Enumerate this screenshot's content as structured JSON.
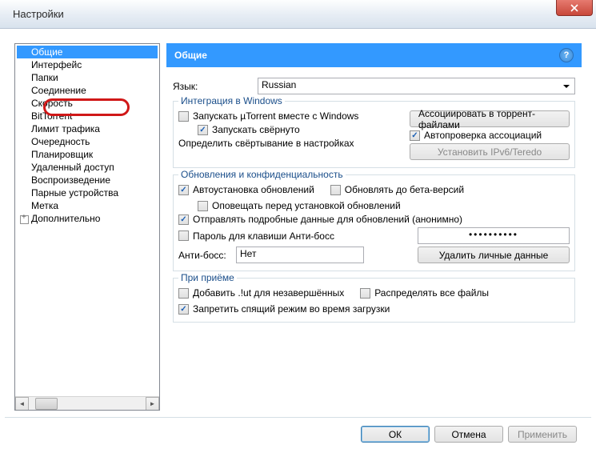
{
  "window": {
    "title": "Настройки"
  },
  "sidebar": {
    "items": [
      {
        "label": "Общие",
        "selected": true
      },
      {
        "label": "Интерфейс"
      },
      {
        "label": "Папки"
      },
      {
        "label": "Соединение"
      },
      {
        "label": "Скорость"
      },
      {
        "label": "BitTorrent"
      },
      {
        "label": "Лимит трафика"
      },
      {
        "label": "Очередность"
      },
      {
        "label": "Планировщик"
      },
      {
        "label": "Удаленный доступ"
      },
      {
        "label": "Воспроизведение"
      },
      {
        "label": "Парные устройства"
      },
      {
        "label": "Метка"
      },
      {
        "label": "Дополнительно",
        "expand": true
      }
    ]
  },
  "header": {
    "title": "Общие"
  },
  "lang": {
    "label": "Язык:",
    "value": "Russian"
  },
  "group_win": {
    "title": "Интеграция в Windows",
    "chk_start": "Запускать µTorrent вместе с Windows",
    "chk_min": "Запускать свёрнуто",
    "btn_assoc": "Ассоциировать в торрент-файлами",
    "chk_auto": "Автопроверка ассоциаций",
    "lbl_define": "Определить свёртывание в настройках",
    "btn_ipv6": "Установить IPv6/Teredo"
  },
  "group_upd": {
    "title": "Обновления и конфиденциальность",
    "chk_auto": "Автоустановка обновлений",
    "chk_beta": "Обновлять до бета-версий",
    "chk_notify": "Оповещать перед установкой обновлений",
    "chk_send": "Отправлять подробные данные для обновлений (анонимно)",
    "chk_boss": "Пароль для клавиши Анти-босс",
    "pwd": "••••••••••",
    "lbl_anti": "Анти-босс:",
    "val_anti": "Нет",
    "btn_del": "Удалить личные данные"
  },
  "group_rcv": {
    "title": "При приёме",
    "chk_ut": "Добавить .!ut для незавершённых",
    "chk_alloc": "Распределять все файлы",
    "chk_sleep": "Запретить спящий режим во время загрузки"
  },
  "footer": {
    "ok": "ОК",
    "cancel": "Отмена",
    "apply": "Применить"
  }
}
